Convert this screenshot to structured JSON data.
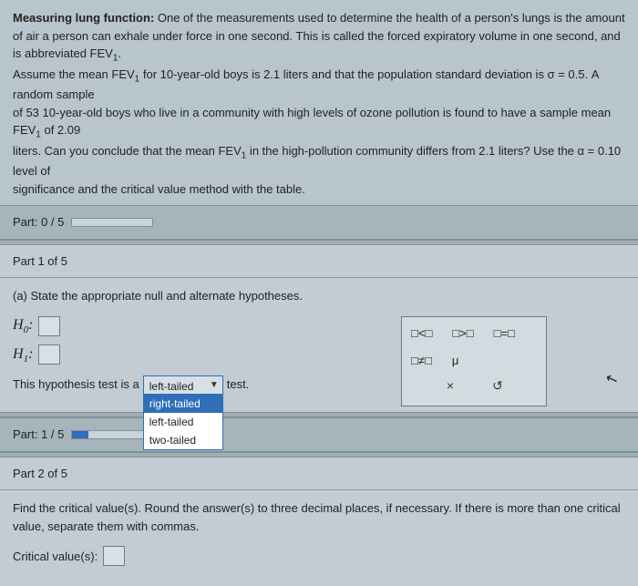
{
  "problem": {
    "title": "Measuring lung function:",
    "paragraph": " One of the measurements used to determine the health of a person's lungs is the amount of air a person can exhale under force in one second. This is called the forced expiratory volume in one second, and is abbreviated FEV",
    "line2a": "Assume the mean FEV",
    "line2b": " for 10-year-old boys is 2.1 liters and that the population standard deviation is σ = 0.5. A random sample",
    "line3a": "of 53 10-year-old boys who live in a community with high levels of ozone pollution is found to have a sample mean FEV",
    "line3b": " of 2.09",
    "line4a": "liters. Can you conclude that the mean FEV",
    "line4b": " in the high-pollution community differs from 2.1 liters? Use the α = 0.10 level of",
    "line5": "significance and the critical value method with the table."
  },
  "part0": {
    "label": "Part: 0 / 5",
    "progress": 0
  },
  "part1bar": {
    "label": "Part 1 of 5"
  },
  "part1": {
    "prompt": "(a) State the appropriate null and alternate hypotheses.",
    "h0_label": "H",
    "h0_sub": "0",
    "h1_label": "H",
    "h1_sub": "1",
    "tail_sentence_a": "This hypothesis test is a ",
    "tail_sentence_b": " test.",
    "tail_selected": "left-tailed",
    "tail_options": [
      "right-tailed",
      "left-tailed",
      "two-tailed"
    ],
    "palette": {
      "lt": "□<□",
      "gt": "□>□",
      "eq": "□=□",
      "ne": "□≠□",
      "mu": "μ",
      "clear": "×",
      "reset": "↺"
    }
  },
  "part1prog": {
    "label": "Part: 1 / 5",
    "progress": 20
  },
  "part2bar": {
    "label": "Part 2 of 5"
  },
  "part2": {
    "prompt": "Find the critical value(s). Round the answer(s) to three decimal places, if necessary. If there is more than one critical value, separate them with commas.",
    "cv_label": "Critical value(s): "
  }
}
